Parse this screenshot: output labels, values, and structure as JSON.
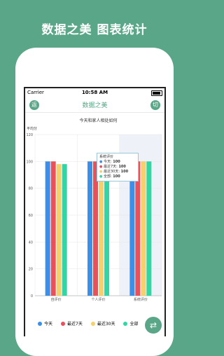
{
  "promo": {
    "title": "数据之美 图表统计"
  },
  "status_bar": {
    "carrier": "Carrier",
    "time": "10:58 AM"
  },
  "nav": {
    "back_label": "返",
    "title": "数据之美",
    "switch_label": "切"
  },
  "colors": {
    "accent": "#5aa688",
    "series": [
      "#3c8fe8",
      "#e8505b",
      "#f5d06b",
      "#2ed8a3"
    ]
  },
  "chart_data": {
    "type": "bar",
    "title": "今天和家人相处如何",
    "ylabel": "平均分",
    "categories": [
      "自评价",
      "个人评价",
      "系统评价"
    ],
    "ylim": [
      0,
      120
    ],
    "yticks": [
      "120",
      "100",
      "80",
      "60",
      "40",
      "20",
      "0"
    ],
    "series": [
      {
        "name": "今天",
        "values": [
          100,
          100,
          100
        ]
      },
      {
        "name": "最近7天",
        "values": [
          100,
          100,
          100
        ]
      },
      {
        "name": "最近30天",
        "values": [
          98,
          100,
          100
        ]
      },
      {
        "name": "全部",
        "values": [
          98,
          100,
          100
        ]
      }
    ],
    "tooltip": {
      "title": "系统评价",
      "rows": [
        {
          "label": "今天:",
          "value": "100"
        },
        {
          "label": "最近7天:",
          "value": "100"
        },
        {
          "label": "最近30天:",
          "value": "100"
        },
        {
          "label": "全部:",
          "value": "100"
        }
      ]
    }
  },
  "fab": {
    "icon": "switch-arrows-icon",
    "glyph": "⇄"
  }
}
